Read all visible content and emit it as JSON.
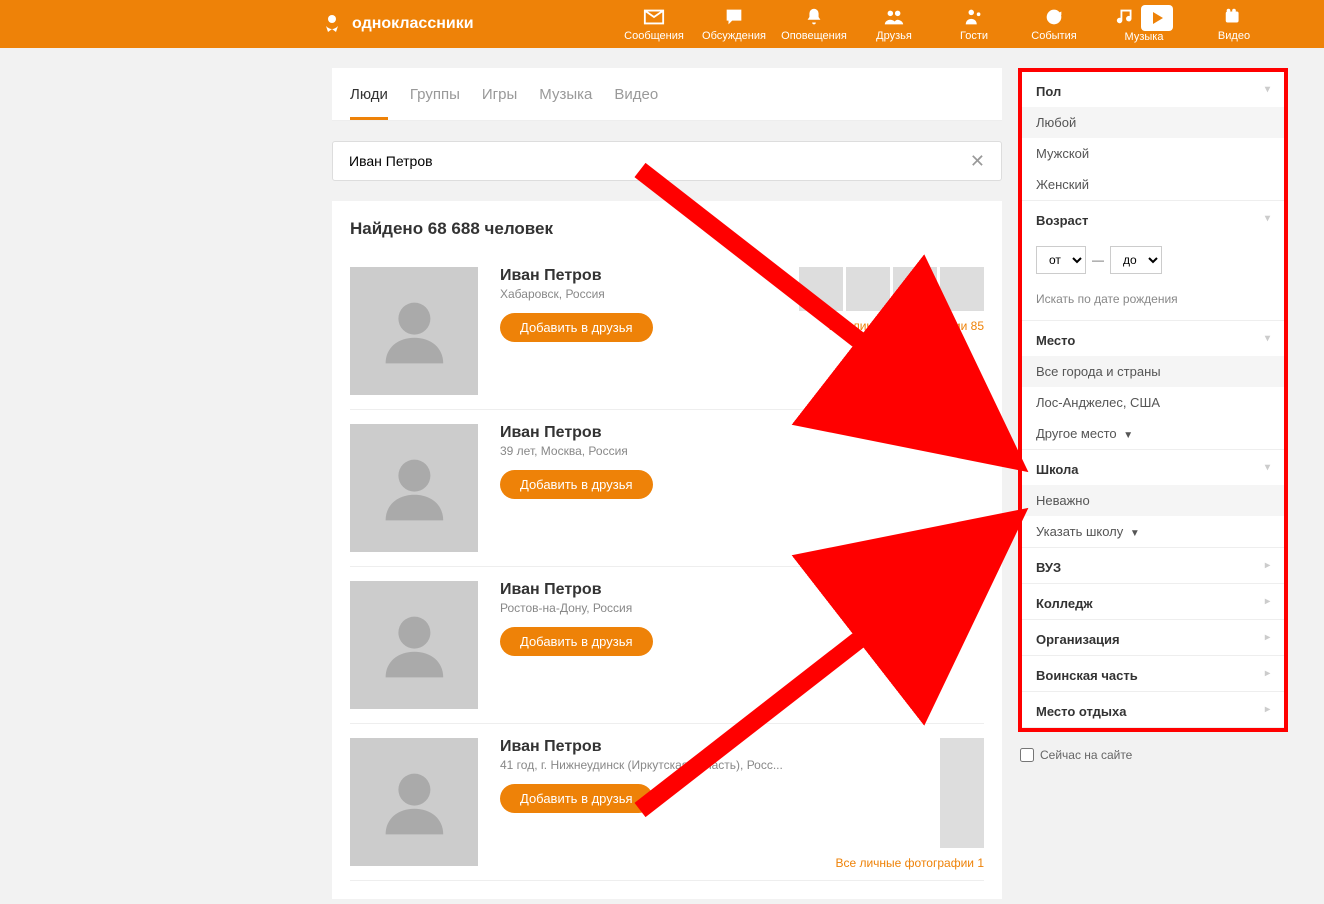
{
  "header": {
    "brand": "одноклассники",
    "nav": [
      {
        "label": "Сообщения",
        "icon": "envelope"
      },
      {
        "label": "Обсуждения",
        "icon": "chat"
      },
      {
        "label": "Оповещения",
        "icon": "bell"
      },
      {
        "label": "Друзья",
        "icon": "people"
      },
      {
        "label": "Гости",
        "icon": "guests"
      },
      {
        "label": "События",
        "icon": "events"
      },
      {
        "label": "Музыка",
        "icon": "music"
      },
      {
        "label": "Видео",
        "icon": "video"
      }
    ]
  },
  "tabs": [
    "Люди",
    "Группы",
    "Игры",
    "Музыка",
    "Видео"
  ],
  "activeTab": 0,
  "search": {
    "value": "Иван Петров"
  },
  "resultsTitle": "Найдено 68 688 человек",
  "addFriend": "Добавить в друзья",
  "results": [
    {
      "name": "Иван Петров",
      "meta": "Хабаровск, Россия",
      "allPhotos": "Все личные фотографии 85",
      "thumbs": 4
    },
    {
      "name": "Иван Петров",
      "meta": "39 лет, Москва, Россия"
    },
    {
      "name": "Иван Петров",
      "meta": "Ростов-на-Дону, Россия"
    },
    {
      "name": "Иван Петров",
      "meta": "41 год, г. Нижнеудинск (Иркутская область), Росс...",
      "allPhotos": "Все личные фотографии 1",
      "single": true
    }
  ],
  "filters": {
    "gender": {
      "title": "Пол",
      "options": [
        "Любой",
        "Мужской",
        "Женский"
      ],
      "selected": 0
    },
    "age": {
      "title": "Возраст",
      "from": "от",
      "to": "до",
      "dash": "—",
      "birth": "Искать по дате рождения"
    },
    "place": {
      "title": "Место",
      "options": [
        "Все города и страны",
        "Лос-Анджелес, США",
        "Другое место"
      ],
      "selected": 0,
      "dropdownAt": 2
    },
    "school": {
      "title": "Школа",
      "options": [
        "Неважно",
        "Указать школу"
      ],
      "selected": 0,
      "dropdownAt": 1
    },
    "collapsed": [
      "ВУЗ",
      "Колледж",
      "Организация",
      "Воинская часть",
      "Место отдыха"
    ]
  },
  "onlineNow": "Сейчас на сайте"
}
